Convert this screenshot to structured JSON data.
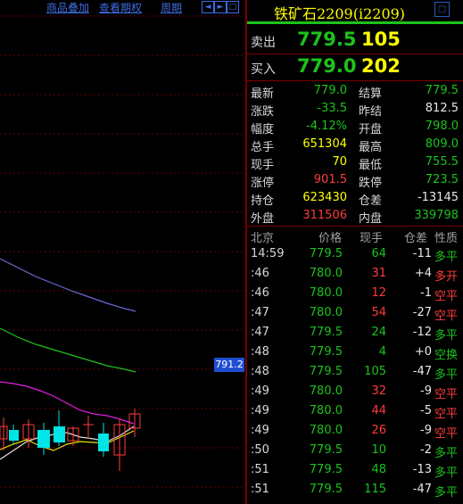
{
  "chart_toolbar": {
    "overlay_label": "商品叠加",
    "period_lookup_label": "查看期权",
    "period_label": "周期",
    "nav_prev": "◄",
    "nav_next": "►",
    "nav_zoom": "□"
  },
  "chart": {
    "current_price_tag": "791.2",
    "colors": {
      "up_candle": "#ff3c3c",
      "down_candle": "#00e5e5",
      "ma_blue": "#6a6ad8",
      "ma_green": "#1cc31c",
      "ma_magenta": "#e020e0",
      "ma_yellow": "#e8e000",
      "ma_white": "#e0e0e0"
    }
  },
  "quote": {
    "title": "铁矿石2209(i2209)",
    "sell_label": "卖出",
    "sell_price": "779.5",
    "sell_volume": "105",
    "buy_label": "买入",
    "buy_price": "779.0",
    "buy_volume": "202",
    "fields": [
      {
        "l1": "最新",
        "v1": "779.0",
        "c1": "green",
        "l2": "结算",
        "v2": "779.5",
        "c2": "green"
      },
      {
        "l1": "涨跌",
        "v1": "-33.5",
        "c1": "green",
        "l2": "昨结",
        "v2": "812.5",
        "c2": "white"
      },
      {
        "l1": "幅度",
        "v1": "-4.12%",
        "c1": "green",
        "l2": "开盘",
        "v2": "798.0",
        "c2": "green"
      },
      {
        "l1": "总手",
        "v1": "651304",
        "c1": "yellow",
        "l2": "最高",
        "v2": "809.0",
        "c2": "green"
      },
      {
        "l1": "现手",
        "v1": "70",
        "c1": "yellow",
        "l2": "最低",
        "v2": "755.5",
        "c2": "green"
      },
      {
        "l1": "涨停",
        "v1": "901.5",
        "c1": "red",
        "l2": "跌停",
        "v2": "723.5",
        "c2": "green"
      },
      {
        "l1": "持仓",
        "v1": "623430",
        "c1": "yellow",
        "l2": "仓差",
        "v2": "-13145",
        "c2": "white"
      },
      {
        "l1": "外盘",
        "v1": "311506",
        "c1": "red",
        "l2": "内盘",
        "v2": "339798",
        "c2": "green"
      }
    ]
  },
  "ticks": {
    "headers": [
      "北京",
      "价格",
      "现手",
      "仓差",
      "性质"
    ],
    "rows": [
      {
        "time": "14:59",
        "price": "779.5",
        "volume": "64",
        "vcolor": "green",
        "oi": "-11",
        "nature": "多平",
        "ncolor": "green"
      },
      {
        "time": ":46",
        "price": "780.0",
        "volume": "31",
        "vcolor": "red",
        "oi": "+4",
        "nature": "多开",
        "ncolor": "red"
      },
      {
        "time": ":46",
        "price": "780.0",
        "volume": "12",
        "vcolor": "red",
        "oi": "-1",
        "nature": "空平",
        "ncolor": "red"
      },
      {
        "time": ":47",
        "price": "780.0",
        "volume": "54",
        "vcolor": "red",
        "oi": "-27",
        "nature": "空平",
        "ncolor": "red"
      },
      {
        "time": ":47",
        "price": "779.5",
        "volume": "24",
        "vcolor": "green",
        "oi": "-12",
        "nature": "多平",
        "ncolor": "green"
      },
      {
        "time": ":48",
        "price": "779.5",
        "volume": "4",
        "vcolor": "green",
        "oi": "+0",
        "nature": "空换",
        "ncolor": "green"
      },
      {
        "time": ":48",
        "price": "779.5",
        "volume": "105",
        "vcolor": "green",
        "oi": "-47",
        "nature": "多平",
        "ncolor": "green"
      },
      {
        "time": ":49",
        "price": "780.0",
        "volume": "32",
        "vcolor": "red",
        "oi": "-9",
        "nature": "空平",
        "ncolor": "red"
      },
      {
        "time": ":49",
        "price": "780.0",
        "volume": "44",
        "vcolor": "red",
        "oi": "-5",
        "nature": "空平",
        "ncolor": "red"
      },
      {
        "time": ":49",
        "price": "780.0",
        "volume": "26",
        "vcolor": "red",
        "oi": "-9",
        "nature": "空平",
        "ncolor": "red"
      },
      {
        "time": ":50",
        "price": "779.5",
        "volume": "10",
        "vcolor": "green",
        "oi": "-2",
        "nature": "多平",
        "ncolor": "green"
      },
      {
        "time": ":51",
        "price": "779.5",
        "volume": "48",
        "vcolor": "green",
        "oi": "-13",
        "nature": "多平",
        "ncolor": "green"
      },
      {
        "time": ":51",
        "price": "779.5",
        "volume": "115",
        "vcolor": "green",
        "oi": "-47",
        "nature": "多平",
        "ncolor": "green"
      }
    ]
  }
}
